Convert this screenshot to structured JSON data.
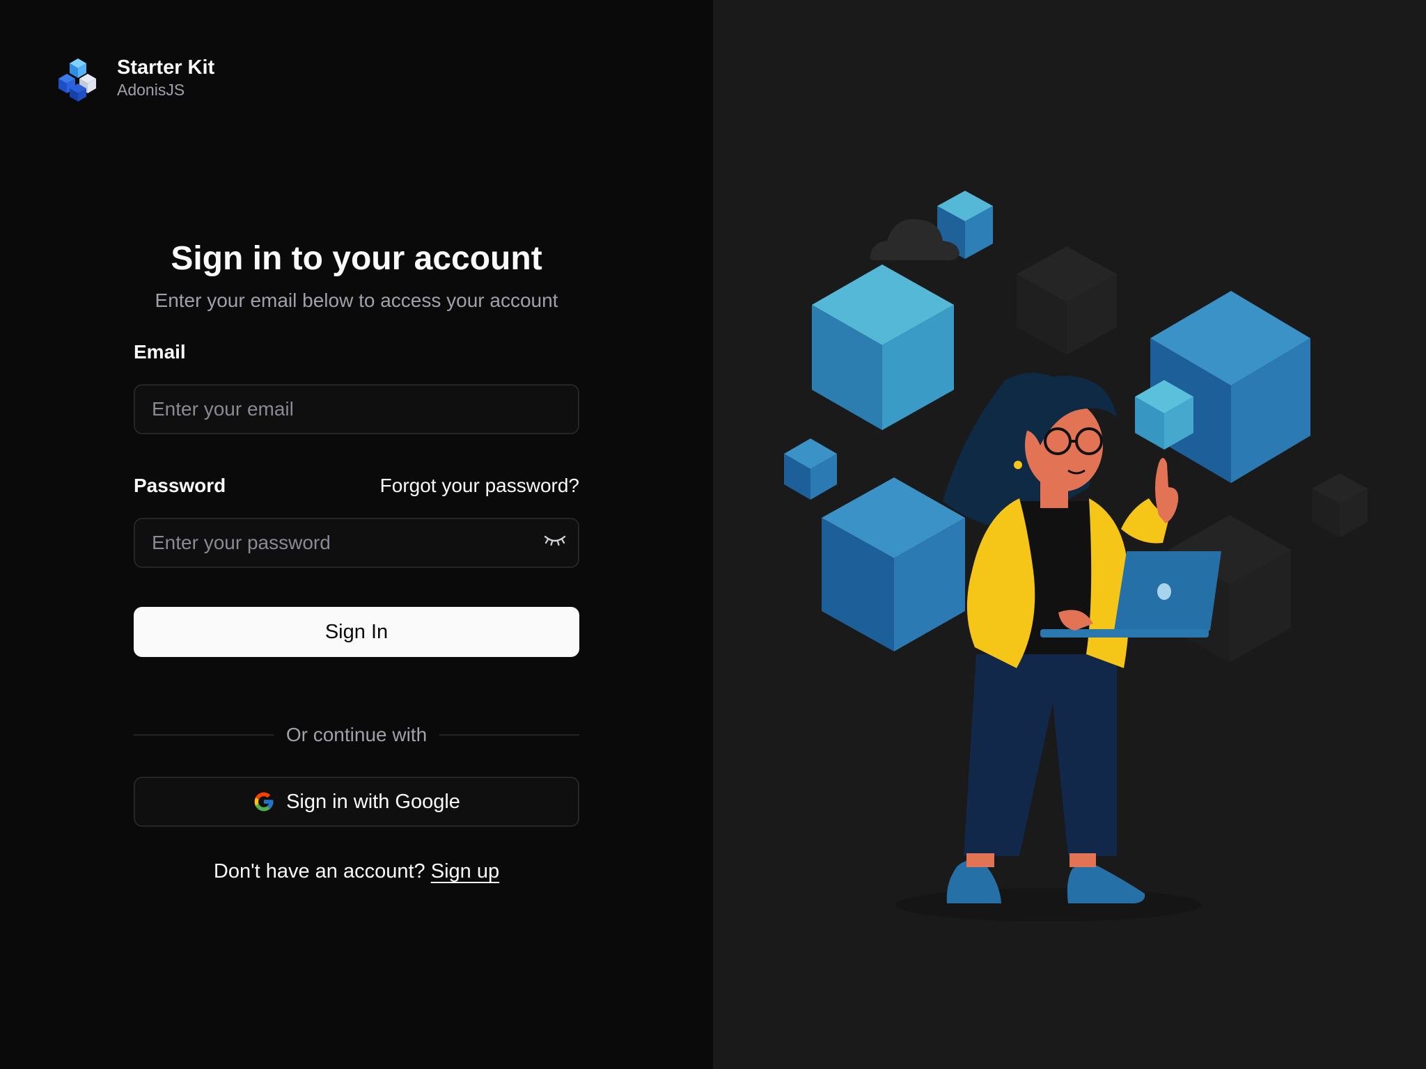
{
  "brand": {
    "title": "Starter Kit",
    "subtitle": "AdonisJS"
  },
  "form": {
    "title": "Sign in to your account",
    "subtitle": "Enter your email below to access your account",
    "email_label": "Email",
    "email_placeholder": "Enter your email",
    "email_value": "",
    "password_label": "Password",
    "forgot_link": "Forgot your password?",
    "password_placeholder": "Enter your password",
    "password_value": "",
    "submit_label": "Sign In",
    "divider_text": "Or continue with",
    "google_label": "Sign in with Google",
    "signup_prompt": "Don't have an account?",
    "signup_link": "Sign up"
  },
  "icons": {
    "logo": "stacked-cubes-logo",
    "password_toggle": "eye-closed-icon",
    "google": "google-icon"
  },
  "colors": {
    "left_bg": "#0a0a0a",
    "right_bg": "#1a1a1a",
    "primary_button": "#fafafa",
    "cube_blue": "#3a8fc4",
    "jacket_yellow": "#f5c518"
  }
}
